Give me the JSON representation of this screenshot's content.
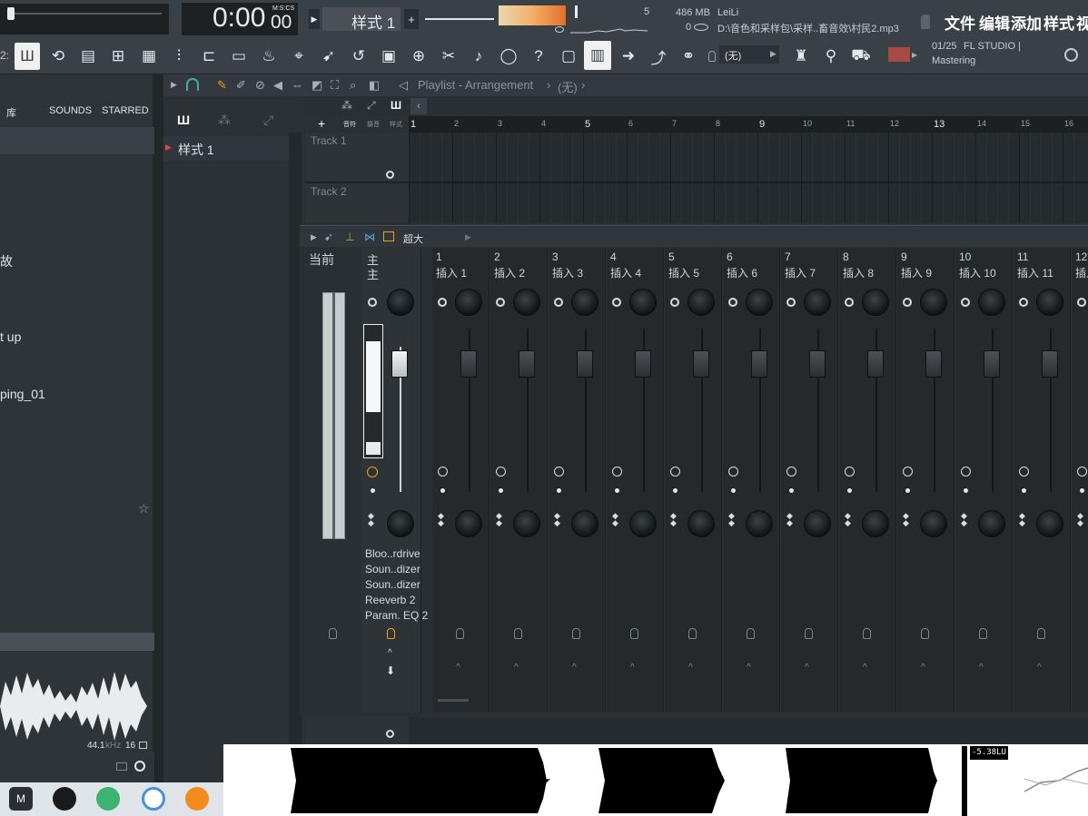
{
  "transport": {
    "time_main": "0:00",
    "time_sub": "00",
    "time_format": "M:S:CS",
    "pattern_name": "样式 1",
    "cpu_value": "5",
    "memory": "486 MB",
    "polyphony": "0"
  },
  "hint": {
    "user": "LeiLi",
    "path": "D:\\音色和采样包\\采样..畜音效\\村民2.mp3"
  },
  "menu": [
    "文件",
    "编辑",
    "添加",
    "样式",
    "视"
  ],
  "toolbar": {
    "snap_value": "(无)",
    "news_counter": "01/25",
    "news_text_1": "FL STUDIO |",
    "news_text_2": "Mastering",
    "partial_left": "2:"
  },
  "browser": {
    "tabs": [
      "库",
      "SOUNDS",
      "STARRED"
    ],
    "items": [
      "故",
      "t up",
      "ping_01"
    ],
    "sample_rate": "44.1",
    "sample_rate_unit": "kHz",
    "bit_depth": "16"
  },
  "playlist": {
    "title": "Playlist - Arrangement",
    "subtitle": "(无)",
    "pattern": "样式 1",
    "tool_labels": [
      "音符",
      "摄音",
      "样式"
    ],
    "ruler": [
      "1",
      "2",
      "3",
      "4",
      "5",
      "6",
      "7",
      "8",
      "9",
      "10",
      "11",
      "12",
      "13",
      "14",
      "15",
      "16"
    ],
    "tracks": [
      "Track 1",
      "Track 2"
    ]
  },
  "mixer": {
    "view_label": "超大",
    "current_label": "当前",
    "master_num": "主",
    "master_name": "主",
    "inserts": [
      {
        "num": "1",
        "name": "插入 1"
      },
      {
        "num": "2",
        "name": "插入 2"
      },
      {
        "num": "3",
        "name": "插入 3"
      },
      {
        "num": "4",
        "name": "插入 4"
      },
      {
        "num": "5",
        "name": "插入 5"
      },
      {
        "num": "6",
        "name": "插入 6"
      },
      {
        "num": "7",
        "name": "插入 7"
      },
      {
        "num": "8",
        "name": "插入 8"
      },
      {
        "num": "9",
        "name": "插入 9"
      },
      {
        "num": "10",
        "name": "插入 10"
      },
      {
        "num": "11",
        "name": "插入 11"
      },
      {
        "num": "12",
        "name": "插入"
      }
    ],
    "master_fx": [
      "Bloo..rdrive",
      "Soun..dizer",
      "Soun..dizer",
      "Reeverb 2",
      "Param. EQ 2"
    ]
  },
  "bottom": {
    "peak_label": "-5.38LU"
  },
  "colors": {
    "accent_orange": "#f0a020",
    "pattern_red": "#e0405a",
    "background": "#2b3034"
  }
}
